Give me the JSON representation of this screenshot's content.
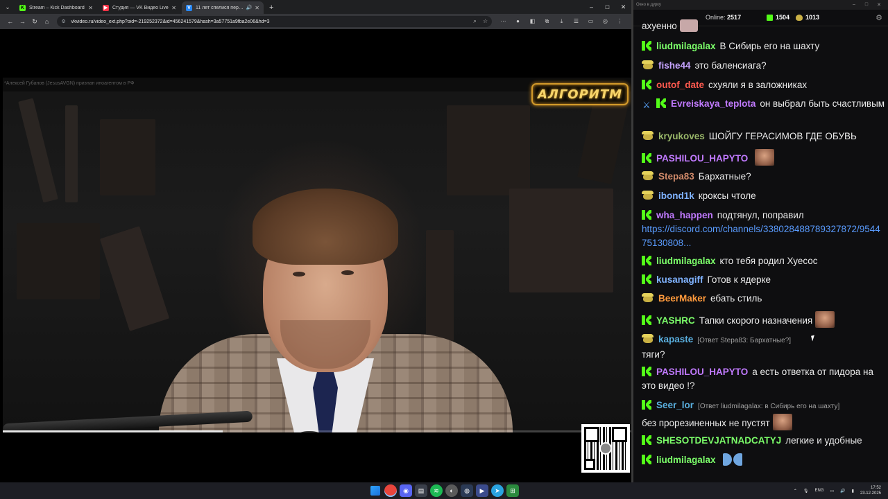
{
  "browser": {
    "tabs": [
      {
        "title": "Stream – Kick Dashboard",
        "icon": "kick-icon",
        "color": "#53fc18",
        "letter": "K"
      },
      {
        "title": "Студия — VK Видео Live",
        "icon": "vk-video-live-icon",
        "color": "#ff3347",
        "letter": "▶"
      },
      {
        "title": "11 лет спелися перед Укр",
        "icon": "vk-video-icon",
        "color": "#2787f5",
        "letter": "V"
      }
    ],
    "new_tab": "+",
    "window_controls": {
      "minimize": "–",
      "maximize": "□",
      "close": "✕"
    },
    "url": "vkvideo.ru/video_ext.php?oid=-219252372&id=456241579&hash=3a57751a9fba2e06&hd=3"
  },
  "video": {
    "notice": "*Алексей Губанов (JesusAVGN) признан иноагентом в РФ",
    "logo_text": "АЛГОРИТМ",
    "progress_fraction": 0.35
  },
  "chat": {
    "window_title": "Окно в дурку",
    "window_controls": {
      "minimize": "–",
      "maximize": "□",
      "close": "✕"
    },
    "online_label": "Online:",
    "online_count": "2517",
    "kick_count": "1504",
    "pepe_count": "1013",
    "messages": [
      {
        "text": "ахуенно",
        "emote": "pink"
      },
      {
        "badge": "kick",
        "user": "liudmilagalax",
        "color": "#7cff6a",
        "text": "В Сибирь его на шахту"
      },
      {
        "badge": "pepe",
        "user": "fishe44",
        "color": "#c6a4ff",
        "text": "это баленсиага?"
      },
      {
        "badge": "kick",
        "user": "outof_date",
        "color": "#ff5a4f",
        "text": "схуяли я в заложниках"
      },
      {
        "badge": "sword+kick",
        "user": "Evreiskaya_teplota",
        "color": "#c17aff",
        "text": "он выбрал быть счастливым"
      },
      {
        "badge": "pepe",
        "user": "kryukoves",
        "color": "#9ab86a",
        "text": "ШОЙГУ ГЕРАСИМОВ ГДЕ ОБУВЬ"
      },
      {
        "badge": "kick",
        "user": "PASHILOU_HAPYTO",
        "color": "#c17aff",
        "text": "",
        "emote": "face"
      },
      {
        "badge": "pepe",
        "user": "Stepa83",
        "color": "#d08a6a",
        "text": "Бархатные?"
      },
      {
        "badge": "pepe",
        "user": "ibond1k",
        "color": "#7fb2ff",
        "text": "кроксы чтоле"
      },
      {
        "badge": "kick",
        "user": "wha_happen",
        "color": "#c17aff",
        "text": "подтянул, поправил",
        "link": "https://discord.com/channels/338028488789327872/954475130808..."
      },
      {
        "badge": "kick",
        "user": "liudmilagalax",
        "color": "#7cff6a",
        "text": "кто тебя родил Хуесос"
      },
      {
        "badge": "kick",
        "user": "kusanagiff",
        "color": "#7fb2ff",
        "text": "Готов к ядерке"
      },
      {
        "badge": "pepe",
        "user": "BeerMaker",
        "color": "#ff9a3c",
        "text": "ебать стиль"
      },
      {
        "badge": "kick",
        "user": "YASHRC",
        "color": "#7cff6a",
        "text": "Тапки скорого назначения",
        "emote": "face"
      },
      {
        "badge": "pepe",
        "user": "kapaste",
        "color": "#5ab0e0",
        "reply": "[Ответ Stepa83: Бархатные?]",
        "text": "тяги?"
      },
      {
        "badge": "kick",
        "user": "PASHILOU_HAPYTO",
        "color": "#c17aff",
        "text": "а есть ответка от пидора на это видео !?"
      },
      {
        "badge": "kick",
        "user": "Seer_lor",
        "color": "#5ab0e0",
        "reply": "[Ответ liudmilagalax: в Сибирь его на шахту]",
        "text": "без прорезиненных не пустят",
        "emote": "face"
      },
      {
        "badge": "kick",
        "user": "SHESOTDEVJATNADCATYJ",
        "color": "#7cff6a",
        "text": "легкие и удобные"
      },
      {
        "badge": "kick",
        "user": "liudmilagalax",
        "color": "#7cff6a",
        "text": "",
        "emote": "blue"
      }
    ]
  },
  "taskbar": {
    "language": "ENG",
    "time": "17:52",
    "date": "23.12.2025"
  }
}
